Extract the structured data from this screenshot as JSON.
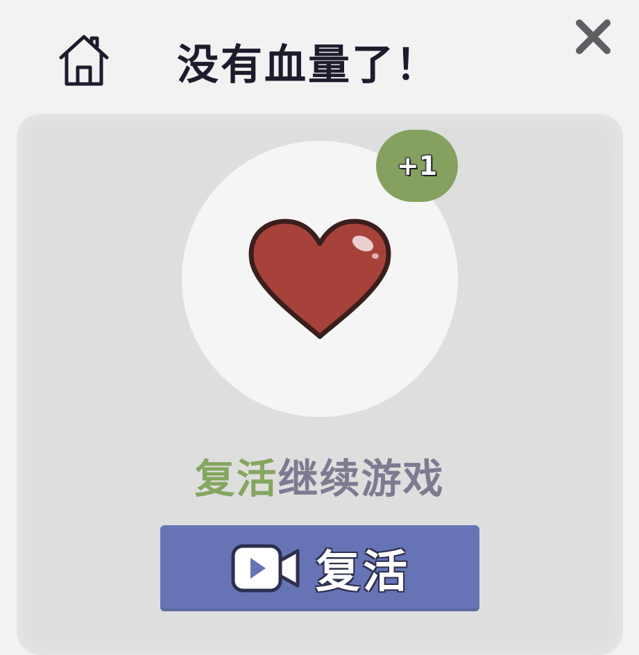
{
  "dialog": {
    "title": "没有血量了！",
    "home_icon": "home-icon",
    "close_icon": "close-icon"
  },
  "reward": {
    "icon": "heart-icon",
    "badge": "+1"
  },
  "message": {
    "highlight": "复活",
    "rest": "继续游戏"
  },
  "revive_button": {
    "icon": "video-camera-icon",
    "label": "复活"
  },
  "colors": {
    "background": "#f2f2f3",
    "panel": "#dedede",
    "accent_green": "#85a65e",
    "button_blue": "#6673b4",
    "heart_red": "#a7423a",
    "title_text": "#1d1c2c"
  }
}
